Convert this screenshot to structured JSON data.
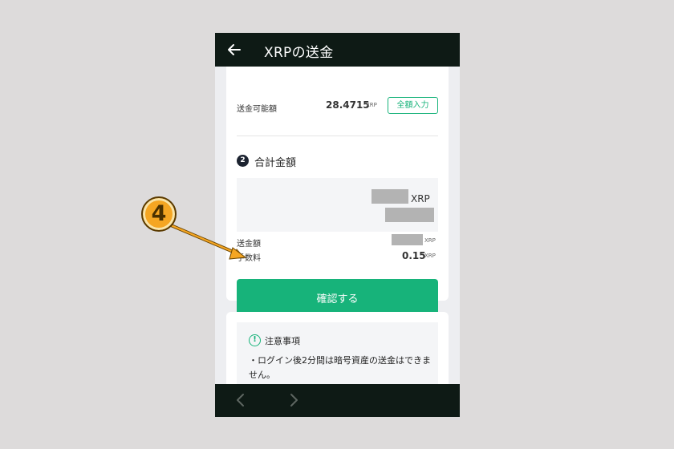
{
  "header": {
    "title": "XRPの送金"
  },
  "available": {
    "label": "送金可能額",
    "value": "28.4715",
    "unit": "XRP",
    "button_label": "全額入力"
  },
  "total_section": {
    "step_number": "2",
    "title": "合計金額",
    "total_unit": "XRP",
    "send_amount_label": "送金額",
    "send_amount_unit": "XRP",
    "fee_label": "手数料",
    "fee_value": "0.15",
    "fee_unit": "XRP"
  },
  "confirm_button": {
    "label": "確認する"
  },
  "notes": {
    "title": "注意事項",
    "text": "・ログイン後2分間は暗号資産の送金はできません。"
  },
  "annotation": {
    "step_marker": "4",
    "marker_color": "#f5a623"
  },
  "colors": {
    "accent": "#17b37a",
    "header_bg": "#0e1a15"
  }
}
